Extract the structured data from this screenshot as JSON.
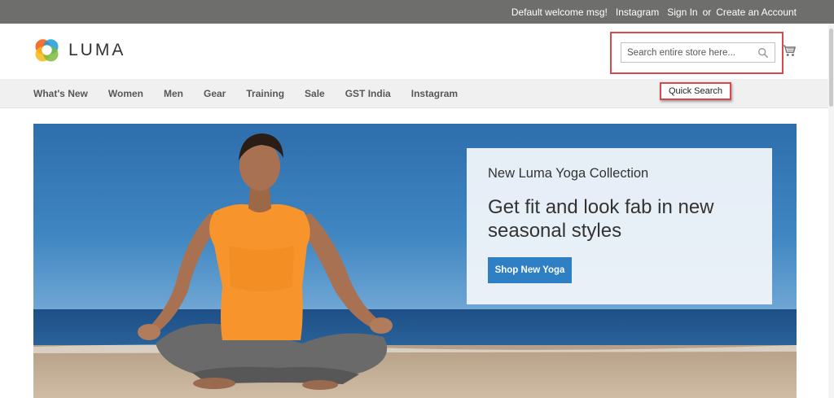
{
  "topbar": {
    "welcome": "Default welcome msg!",
    "instagram": "Instagram",
    "sign_in": "Sign In",
    "or": "or",
    "create_account": "Create an Account"
  },
  "header": {
    "logo_text": "LUMA",
    "search_placeholder": "Search entire store here...",
    "search_icon": "search-icon",
    "cart_icon": "cart-icon"
  },
  "nav": {
    "items": [
      "What's New",
      "Women",
      "Men",
      "Gear",
      "Training",
      "Sale",
      "GST India",
      "Instagram"
    ]
  },
  "annotation": {
    "label": "Quick Search",
    "highlight_color": "#d9484a"
  },
  "hero": {
    "subtitle": "New Luma Yoga Collection",
    "headline": "Get fit and look fab in new seasonal styles",
    "cta_label": "Shop New Yoga",
    "cta_color": "#2e7fc3"
  },
  "colors": {
    "topbar_bg": "#6e6e6c",
    "nav_bg": "#f0f0f0",
    "logo_orange": "#f26322",
    "logo_green": "#7cbb3e",
    "logo_blue": "#1c9bd7"
  }
}
